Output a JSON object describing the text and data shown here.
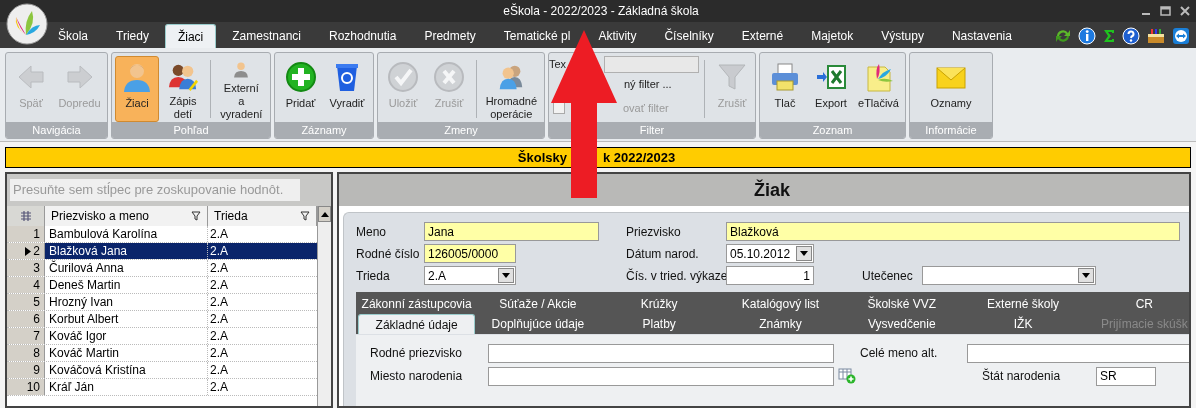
{
  "window": {
    "title": "eŠkola - 2022/2023 - Základná škola"
  },
  "menu_tabs": [
    {
      "label": "Škola",
      "selected": false
    },
    {
      "label": "Triedy",
      "selected": false
    },
    {
      "label": "Žiaci",
      "selected": true
    },
    {
      "label": "Zamestnanci",
      "selected": false
    },
    {
      "label": "Rozhodnutia",
      "selected": false
    },
    {
      "label": "Predmety",
      "selected": false
    },
    {
      "label": "Tematické pl",
      "selected": false
    },
    {
      "label": "Aktivity",
      "selected": false
    },
    {
      "label": "Číselníky",
      "selected": false
    },
    {
      "label": "Externé",
      "selected": false
    },
    {
      "label": "Majetok",
      "selected": false
    },
    {
      "label": "Výstupy",
      "selected": false
    },
    {
      "label": "Nastavenia",
      "selected": false
    }
  ],
  "ribbon_groups": [
    {
      "title": "Navigácia",
      "items": [
        {
          "kind": "button",
          "label": "Späť",
          "disabled": true,
          "selected": false
        },
        {
          "kind": "button",
          "label": "Dopredu",
          "disabled": true,
          "selected": false
        }
      ]
    },
    {
      "title": "Pohľad",
      "items": [
        {
          "kind": "button",
          "label": "Žiaci",
          "disabled": false,
          "selected": true
        },
        {
          "kind": "button",
          "label": "Zápis detí",
          "disabled": false,
          "selected": false
        },
        {
          "kind": "button",
          "label": "Externí a vyradení",
          "disabled": false,
          "selected": false,
          "separator_before": true
        }
      ]
    },
    {
      "title": "Záznamy",
      "items": [
        {
          "kind": "button",
          "label": "Pridať",
          "disabled": false,
          "selected": false
        },
        {
          "kind": "button",
          "label": "Vyradiť",
          "disabled": false,
          "selected": false
        }
      ]
    },
    {
      "title": "Zmeny",
      "items": [
        {
          "kind": "button",
          "label": "Uložiť",
          "disabled": true,
          "selected": false
        },
        {
          "kind": "button",
          "label": "Zrušiť",
          "disabled": true,
          "selected": false
        },
        {
          "kind": "button",
          "label": "Hromadné operácie",
          "disabled": false,
          "selected": false,
          "separator_before": true
        }
      ]
    },
    {
      "title": "Filter",
      "items": [
        {
          "kind": "field",
          "label": "Tex"
        },
        {
          "kind": "link",
          "label": "ný filter ..."
        },
        {
          "kind": "checkbox",
          "label": "ovať filter",
          "checked": false,
          "disabled": true
        },
        {
          "kind": "button",
          "label": "Zrušiť",
          "disabled": true,
          "selected": false,
          "separator_before": true
        }
      ]
    },
    {
      "title": "Zoznam",
      "items": [
        {
          "kind": "button",
          "label": "Tlač",
          "disabled": false,
          "selected": false
        },
        {
          "kind": "button",
          "label": "Export",
          "disabled": false,
          "selected": false
        },
        {
          "kind": "button",
          "label": "eTlačivá",
          "disabled": false,
          "selected": false
        }
      ]
    },
    {
      "title": "Informácie",
      "items": [
        {
          "kind": "button",
          "label": "Oznamy",
          "disabled": false,
          "selected": false
        }
      ]
    }
  ],
  "banner": {
    "text_before": "Školsky",
    "text_after": "k 2022/2023"
  },
  "grid": {
    "group_placeholder": "Presuňte sem stĺpec pre zoskupovanie hodnôt.",
    "columns": [
      "Priezvisko a meno",
      "Trieda"
    ],
    "rows": [
      {
        "number": "1",
        "name": "Bambulová Karolína",
        "class": "2.A",
        "selected": false
      },
      {
        "number": "2",
        "name": "Blažková Jana",
        "class": "2.A",
        "selected": true
      },
      {
        "number": "3",
        "name": "Čurilová Anna",
        "class": "2.A",
        "selected": false
      },
      {
        "number": "4",
        "name": "Deneš Martin",
        "class": "2.A",
        "selected": false
      },
      {
        "number": "5",
        "name": "Hrozný Ivan",
        "class": "2.A",
        "selected": false
      },
      {
        "number": "6",
        "name": "Korbut Albert",
        "class": "2.A",
        "selected": false
      },
      {
        "number": "7",
        "name": "Kováč Igor",
        "class": "2.A",
        "selected": false
      },
      {
        "number": "8",
        "name": "Kováč Martin",
        "class": "2.A",
        "selected": false
      },
      {
        "number": "9",
        "name": "Kováčová Kristína",
        "class": "2.A",
        "selected": false
      },
      {
        "number": "10",
        "name": "Kráľ Ján",
        "class": "2.A",
        "selected": false
      }
    ]
  },
  "detail": {
    "title": "Žiak",
    "rows": [
      [
        {
          "label": "Meno",
          "value": "Jana",
          "kind": "text",
          "required": true
        },
        {
          "label": "Priezvisko",
          "value": "Blažková",
          "kind": "text",
          "required": true
        }
      ],
      [
        {
          "label": "Rodné číslo",
          "value": "126005/0000",
          "kind": "text",
          "required": true
        },
        {
          "label": "Dátum narod.",
          "value": "05.10.2012",
          "kind": "dropdown",
          "required": false
        }
      ],
      [
        {
          "label": "Trieda",
          "value": "2.A",
          "kind": "dropdown",
          "required": false
        },
        {
          "label": "Čís. v tried. výkaze",
          "value": "1",
          "kind": "number",
          "required": false
        },
        {
          "label": "Utečenec",
          "kind": "dropdown",
          "required": false
        }
      ]
    ],
    "tabs_back": [
      {
        "label": "Zákonní zástupcovia",
        "disabled": false
      },
      {
        "label": "Súťaže / Akcie",
        "disabled": false
      },
      {
        "label": "Krúžky",
        "disabled": false
      },
      {
        "label": "Katalógový list",
        "disabled": false
      },
      {
        "label": "Školské VVZ",
        "disabled": false
      },
      {
        "label": "Externé školy",
        "disabled": false
      },
      {
        "label": "CR",
        "disabled": false
      }
    ],
    "tabs_front": [
      {
        "label": "Základné údaje",
        "selected": true,
        "disabled": false
      },
      {
        "label": "Doplňujúce údaje",
        "selected": false,
        "disabled": false
      },
      {
        "label": "Platby",
        "selected": false,
        "disabled": false
      },
      {
        "label": "Známky",
        "selected": false,
        "disabled": false
      },
      {
        "label": "Vysvedčenie",
        "selected": false,
        "disabled": false
      },
      {
        "label": "IŽK",
        "selected": false,
        "disabled": false
      },
      {
        "label": "Prijímacie skúšk",
        "selected": false,
        "disabled": true
      }
    ],
    "content_rows": [
      [
        {
          "label": "Rodné priezvisko"
        },
        {
          "label": "Celé meno alt."
        }
      ],
      [
        {
          "label": "Miesto narodenia",
          "add_button": true
        },
        {
          "label": "Štát narodenia",
          "value": "SR"
        }
      ]
    ]
  }
}
